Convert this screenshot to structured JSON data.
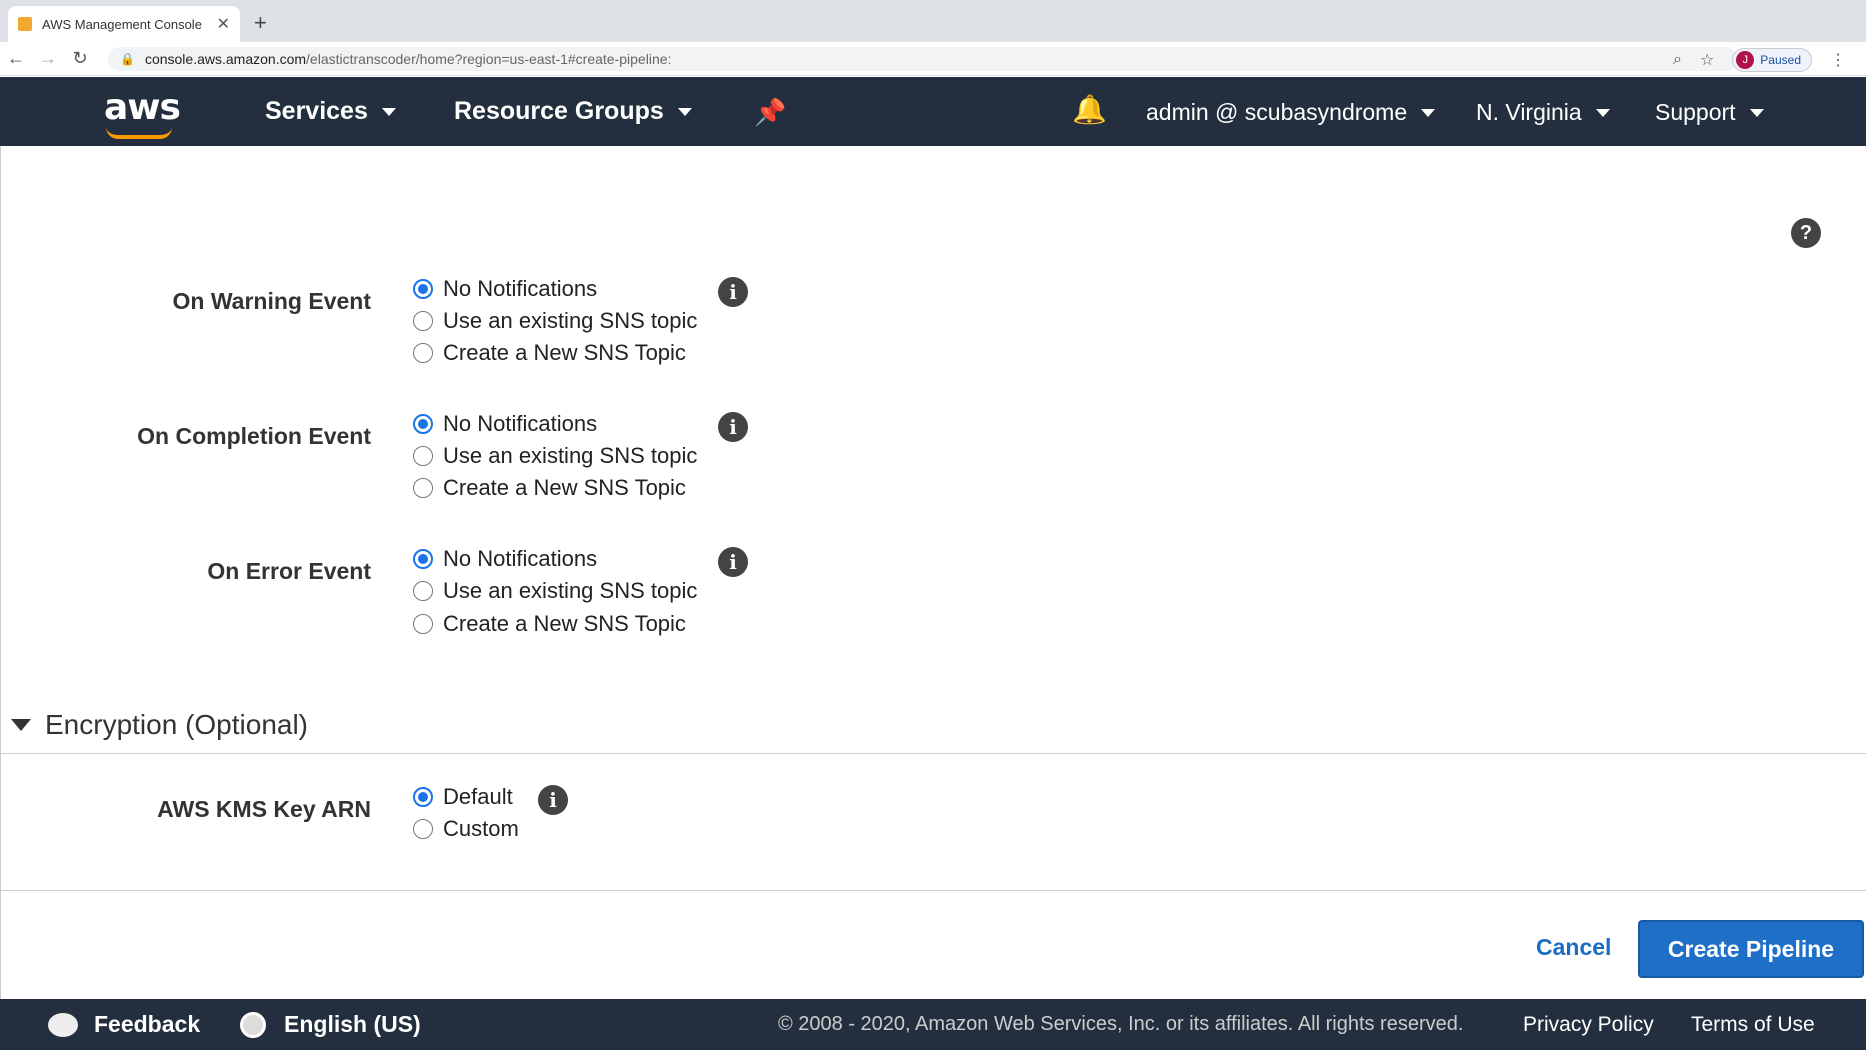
{
  "browser": {
    "tab_title": "AWS Management Console",
    "url_host": "console.aws.amazon.com",
    "url_path": "/elastictranscoder/home?region=us-east-1#create-pipeline:",
    "profile_initial": "J",
    "profile_status": "Paused"
  },
  "nav": {
    "services": "Services",
    "resource_groups": "Resource Groups",
    "account": "admin @ scubasyndrome",
    "region": "N. Virginia",
    "support": "Support"
  },
  "events": [
    {
      "label": "On Warning Event",
      "options": [
        "No Notifications",
        "Use an existing SNS topic",
        "Create a New SNS Topic"
      ],
      "selected": 0
    },
    {
      "label": "On Completion Event",
      "options": [
        "No Notifications",
        "Use an existing SNS topic",
        "Create a New SNS Topic"
      ],
      "selected": 0
    },
    {
      "label": "On Error Event",
      "options": [
        "No Notifications",
        "Use an existing SNS topic",
        "Create a New SNS Topic"
      ],
      "selected": 0
    }
  ],
  "encryption": {
    "title": "Encryption (Optional)",
    "label": "AWS KMS Key ARN",
    "options": [
      "Default",
      "Custom"
    ],
    "selected": 0
  },
  "actions": {
    "cancel": "Cancel",
    "create": "Create Pipeline"
  },
  "footer": {
    "feedback": "Feedback",
    "language": "English (US)",
    "copyright": "© 2008 - 2020, Amazon Web Services, Inc. or its affiliates. All rights reserved.",
    "privacy": "Privacy Policy",
    "terms": "Terms of Use"
  },
  "colors": {
    "aws_nav_bg": "#232f3e",
    "aws_orange": "#ff9900",
    "primary_button": "#1f6fc8",
    "link": "#1a6dc2"
  }
}
